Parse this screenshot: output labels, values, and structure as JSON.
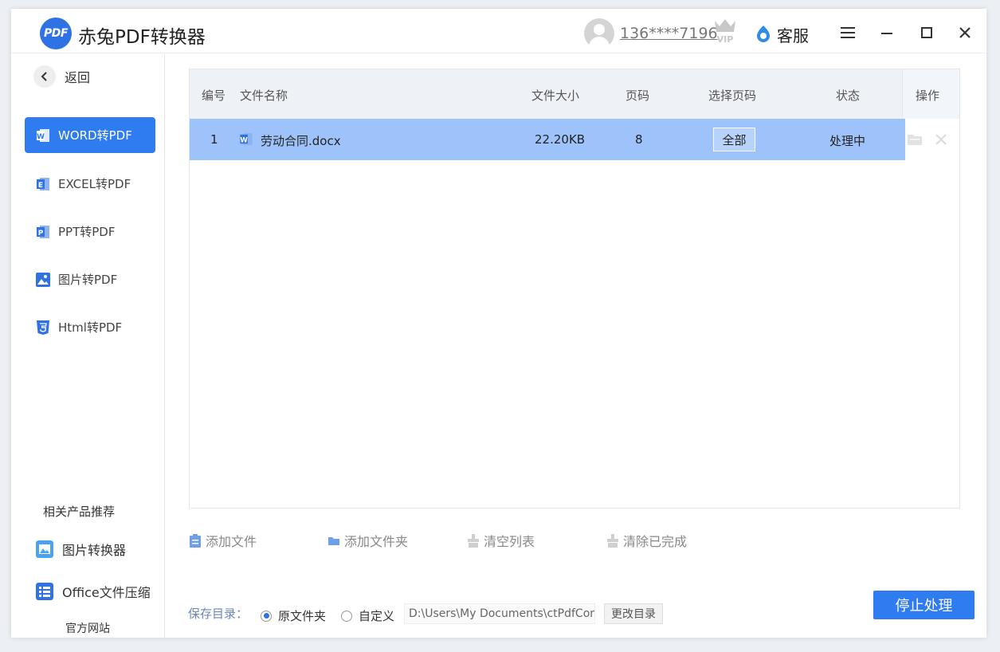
{
  "app": {
    "logo_text": "PDF",
    "title": "赤兔PDF转换器"
  },
  "header": {
    "username": "136****7196",
    "vip_badge": "VIP",
    "service_label": "客服"
  },
  "sidebar": {
    "back_label": "返回",
    "items": [
      {
        "label": "WORD转PDF",
        "icon": "word-icon",
        "active": true
      },
      {
        "label": "EXCEL转PDF",
        "icon": "excel-icon",
        "active": false
      },
      {
        "label": "PPT转PDF",
        "icon": "ppt-icon",
        "active": false
      },
      {
        "label": "图片转PDF",
        "icon": "image-icon",
        "active": false
      },
      {
        "label": "Html转PDF",
        "icon": "html5-icon",
        "active": false
      }
    ],
    "recommend_title": "相关产品推荐",
    "recommend": [
      {
        "label": "图片转换器",
        "icon": "image-converter-icon"
      },
      {
        "label": "Office文件压缩",
        "icon": "office-compress-icon"
      }
    ],
    "official_site": "官方网站"
  },
  "table": {
    "columns": [
      "编号",
      "文件名称",
      "文件大小",
      "页码",
      "选择页码",
      "状态",
      "操作"
    ],
    "rows": [
      {
        "index": "1",
        "name": "劳动合同.docx",
        "size": "22.20KB",
        "pages": "8",
        "page_select": "全部",
        "status": "处理中"
      }
    ]
  },
  "toolbar": {
    "add_file": "添加文件",
    "add_folder": "添加文件夹",
    "clear_list": "清空列表",
    "clear_done": "清除已完成"
  },
  "save": {
    "label": "保存目录：",
    "option_original": "原文件夹",
    "option_custom": "自定义",
    "selected": "原文件夹",
    "path": "D:\\Users\\My Documents\\ctPdfCon",
    "change_button": "更改目录"
  },
  "actions": {
    "stop_button": "停止处理"
  },
  "colors": {
    "accent": "#2f7bf0",
    "row_selected": "#9ec3fa",
    "header_bg": "#eef2f7"
  }
}
